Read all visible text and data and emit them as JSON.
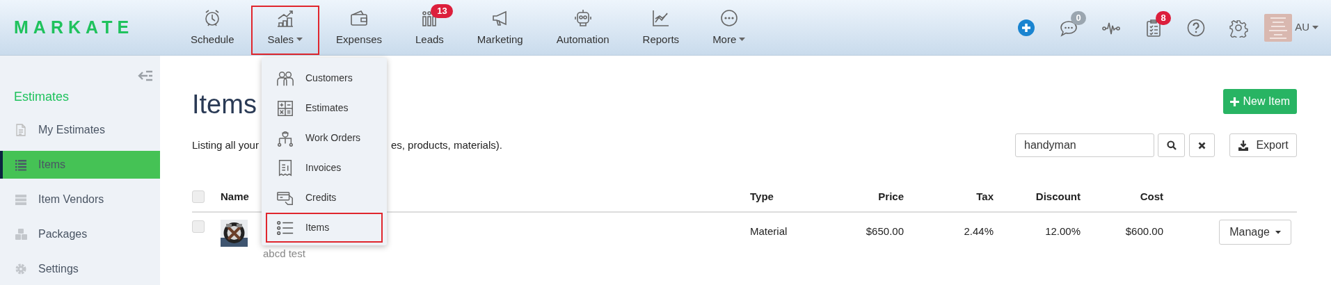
{
  "logo": "MARKATE",
  "nav": [
    {
      "label": "Schedule",
      "caret": false,
      "highlighted": false
    },
    {
      "label": "Sales",
      "caret": true,
      "highlighted": true
    },
    {
      "label": "Expenses",
      "caret": false,
      "highlighted": false
    },
    {
      "label": "Leads",
      "caret": false,
      "highlighted": false,
      "badge": {
        "text": "13",
        "color": "#dc1f3c"
      }
    },
    {
      "label": "Marketing",
      "caret": false,
      "highlighted": false
    },
    {
      "label": "Automation",
      "caret": false,
      "highlighted": false
    },
    {
      "label": "Reports",
      "caret": false,
      "highlighted": false
    },
    {
      "label": "More",
      "caret": true,
      "highlighted": false
    }
  ],
  "toolbar": [
    {
      "kind": "add"
    },
    {
      "kind": "chat",
      "badge": {
        "text": "0",
        "color": "#9ba6b0"
      }
    },
    {
      "kind": "activity"
    },
    {
      "kind": "tasks",
      "badge": {
        "text": "8",
        "color": "#dc1f3c"
      }
    },
    {
      "kind": "help"
    },
    {
      "kind": "settings"
    }
  ],
  "user": {
    "initials": "AU"
  },
  "sidebar": {
    "title": "Estimates",
    "items": [
      {
        "label": "My Estimates",
        "selected": false
      },
      {
        "label": "Items",
        "selected": true
      },
      {
        "label": "Item Vendors",
        "selected": false
      },
      {
        "label": "Packages",
        "selected": false
      },
      {
        "label": "Settings",
        "selected": false
      }
    ]
  },
  "page": {
    "title": "Items",
    "intro": [
      "Listing all your",
      "es, products, materials)."
    ],
    "new_button": "New Item",
    "search": {
      "value": "handyman"
    },
    "export_button": "Export"
  },
  "table": {
    "columns": [
      "Name",
      "Type",
      "Price",
      "Tax",
      "Discount",
      "Cost"
    ],
    "header_checked": false,
    "rows": [
      {
        "checked": false,
        "description": "abcd test",
        "type": "Material",
        "price": "$650.00",
        "tax": "2.44%",
        "discount": "12.00%",
        "cost": "$600.00",
        "action": "Manage"
      }
    ]
  },
  "dropdown": {
    "items": [
      {
        "label": "Customers",
        "highlighted": false
      },
      {
        "label": "Estimates",
        "highlighted": false
      },
      {
        "label": "Work Orders",
        "highlighted": false
      },
      {
        "label": "Invoices",
        "highlighted": false
      },
      {
        "label": "Credits",
        "highlighted": false
      },
      {
        "label": "Items",
        "highlighted": true
      }
    ]
  }
}
